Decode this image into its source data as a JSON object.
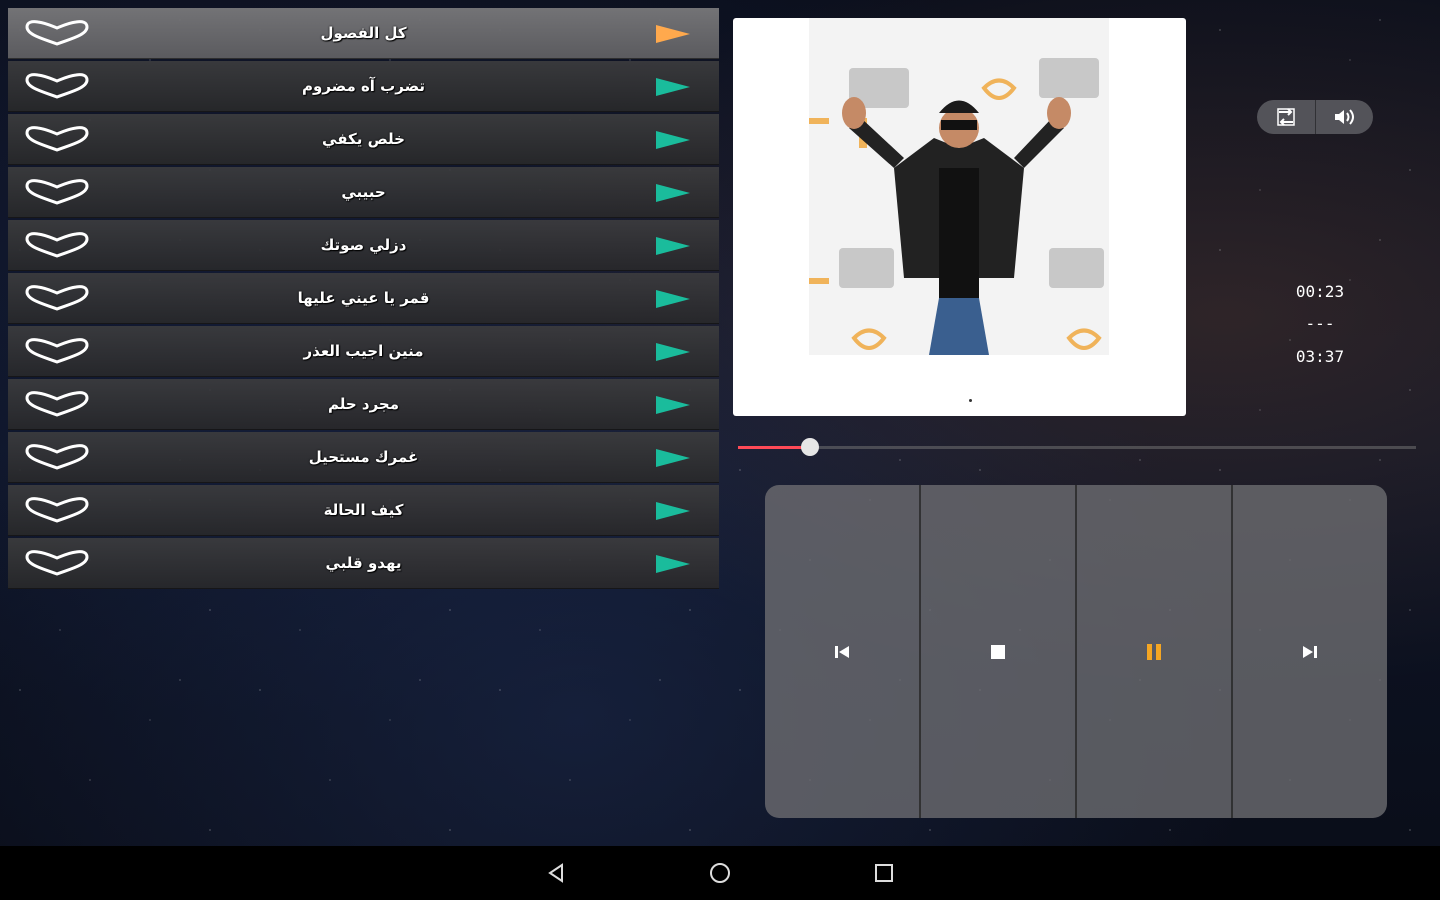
{
  "songs": [
    {
      "title": "كل الفصول",
      "active": true
    },
    {
      "title": "تضرب آه مضروم",
      "active": false
    },
    {
      "title": "خلص يكفي",
      "active": false
    },
    {
      "title": "حبيبي",
      "active": false
    },
    {
      "title": "دزلي صوتك",
      "active": false
    },
    {
      "title": "قمر يا عيني عليها",
      "active": false
    },
    {
      "title": "منين اجيب العذر",
      "active": false
    },
    {
      "title": "مجرد حلم",
      "active": false
    },
    {
      "title": "غمرك مستحيل",
      "active": false
    },
    {
      "title": "كيف الحالة",
      "active": false
    },
    {
      "title": "يهدو قلبي",
      "active": false
    }
  ],
  "icons": {
    "favorite": "heart-outline-icon",
    "play": "play-flag-icon",
    "repeat": "repeat-icon",
    "volume": "volume-icon",
    "previous": "skip-previous-icon",
    "stop": "stop-icon",
    "pause": "pause-icon",
    "next": "skip-next-icon"
  },
  "colors": {
    "active_play": "#ffa94d",
    "inactive_play": "#1abc9c",
    "seek_fill": "#ff4a57",
    "pause": "#f5a623"
  },
  "player": {
    "elapsed": "00:23",
    "separator": "---",
    "duration": "03:37",
    "progress_fraction": 0.106
  }
}
